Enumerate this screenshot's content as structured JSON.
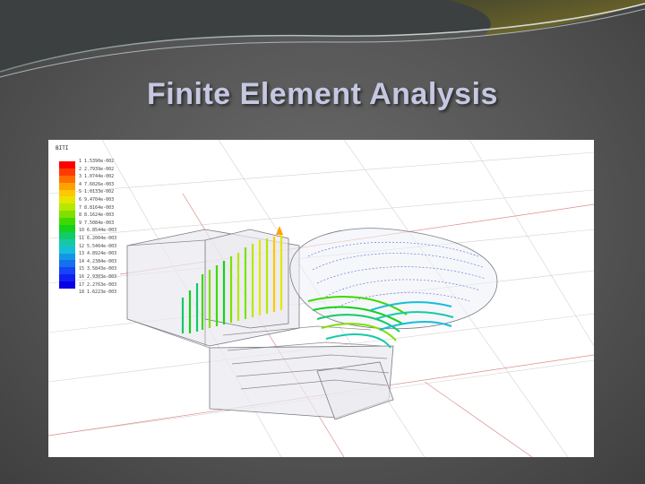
{
  "slide": {
    "title": "Finite Element Analysis"
  },
  "figure": {
    "legend": {
      "title": "BITI",
      "colors": [
        "#ff0000",
        "#ff3a00",
        "#ff6f00",
        "#ffa200",
        "#ffc800",
        "#e5e500",
        "#b6e800",
        "#7fe000",
        "#3fd900",
        "#14d21a",
        "#12c96b",
        "#16c9a6",
        "#16bddb",
        "#1496e6",
        "#1470ef",
        "#1446f5",
        "#1020f5",
        "#0a00e6"
      ],
      "labels": [
        "1.5390e-002",
        "2.7939e-002",
        "1.0744e-002",
        "7.6026e-003",
        "1.0133e-002",
        "9.4704e-003",
        "8.8164e-003",
        "8.1624e-003",
        "7.5084e-003",
        "6.8544e-003",
        "6.2004e-003",
        "5.5464e-003",
        "4.8924e-003",
        "4.2384e-003",
        "3.5843e-003",
        "2.9303e-003",
        "2.2763e-003",
        "1.6223e-003"
      ]
    }
  }
}
